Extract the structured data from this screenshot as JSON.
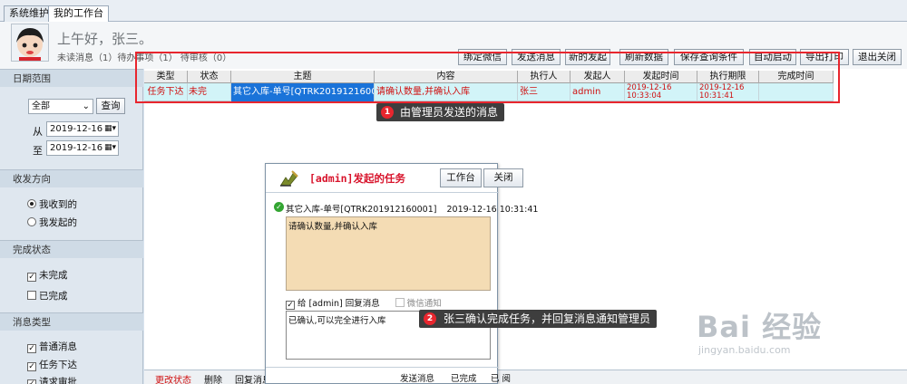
{
  "tabs": [
    {
      "label": "系统维护"
    },
    {
      "label": "我的工作台"
    }
  ],
  "header": {
    "greeting": "上午好，张三。",
    "status_line": "未读消息（1）待办事项（1） 待审核（0）"
  },
  "toolbar": [
    {
      "label": "绑定微信"
    },
    {
      "label": "发送消息"
    },
    {
      "label": "新的发起"
    },
    {
      "label": "刷新数据"
    },
    {
      "label": "保存查询条件"
    },
    {
      "label": "自动启动"
    },
    {
      "label": "导出打印"
    },
    {
      "label": "退出关闭"
    }
  ],
  "sidebar": {
    "date_range": {
      "title": "日期范围",
      "select_value": "全部",
      "query_button": "查询",
      "from_label": "从",
      "from_value": "2019-12-16",
      "to_label": "至",
      "to_value": "2019-12-16"
    },
    "direction": {
      "title": "收发方向",
      "options": [
        {
          "label": "我收到的",
          "checked": true
        },
        {
          "label": "我发起的",
          "checked": false
        }
      ]
    },
    "completion": {
      "title": "完成状态",
      "options": [
        {
          "label": "未完成",
          "checked": true
        },
        {
          "label": "已完成",
          "checked": false
        }
      ]
    },
    "msg_type": {
      "title": "消息类型",
      "options": [
        {
          "label": "普通消息",
          "checked": true
        },
        {
          "label": "任务下达",
          "checked": true
        },
        {
          "label": "请求审批",
          "checked": true
        }
      ]
    }
  },
  "grid": {
    "columns": [
      "类型",
      "状态",
      "主题",
      "内容",
      "执行人",
      "发起人",
      "发起时间",
      "执行期限",
      "完成时间"
    ],
    "rows": [
      {
        "type": "任务下达",
        "status": "未完",
        "subject": "其它入库-单号[QTRK201912160001]",
        "content": "请确认数量,并确认入库",
        "executor": "张三",
        "initiator": "admin",
        "start_date": "2019-12-16",
        "start_time": "10:33:04",
        "deadline_date": "2019-12-16",
        "deadline_time": "10:31:41",
        "finish_time": ""
      }
    ]
  },
  "callouts": [
    {
      "num": "1",
      "text": "由管理员发送的消息"
    },
    {
      "num": "2",
      "text": "张三确认完成任务，并回复消息通知管理员"
    }
  ],
  "bottombar": {
    "items": [
      "更改状态",
      "删除",
      "回复消息"
    ]
  },
  "dialog": {
    "title": "[admin]发起的任务",
    "workbench_button": "工作台",
    "close_button": "关闭",
    "subject": "其它入库-单号[QTRK201912160001]",
    "subject_time": "2019-12-16 10:31:41",
    "content": "请确认数量,并确认入库",
    "reply_label": "给 [admin] 回复消息",
    "wechat_label": "微信通知",
    "reply_text": "已确认,可以完全进行入库",
    "send_button": "发送消息",
    "complete_button": "已完成",
    "read_button": "已 阅"
  },
  "watermark": {
    "text": "Bai 经验",
    "url": "jingyan.baidu.com"
  },
  "colors": {
    "accent_red": "#e8262e",
    "row_highlight": "#d2f4f8",
    "selected_cell": "#1a73d9",
    "content_bg": "#f4dcb4"
  }
}
